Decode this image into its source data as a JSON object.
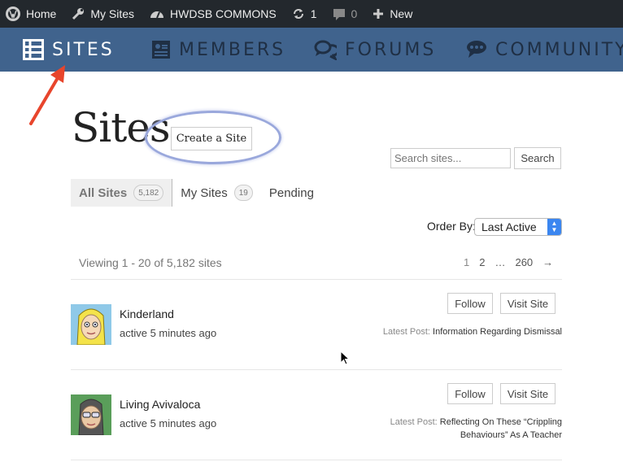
{
  "adminbar": {
    "home_label": "Home",
    "mysites_label": "My Sites",
    "site_name": "HWDSB COMMONS",
    "updates_count": "1",
    "comments_count": "0",
    "new_label": "New"
  },
  "nav": {
    "items": [
      {
        "label": "SITES",
        "icon": "sites-icon"
      },
      {
        "label": "MEMBERS",
        "icon": "members-icon"
      },
      {
        "label": "FORUMS",
        "icon": "forums-icon"
      },
      {
        "label": "COMMUNITY",
        "icon": "community-icon"
      }
    ]
  },
  "page": {
    "title": "Sites",
    "create_label": "Create a Site"
  },
  "search": {
    "placeholder": "Search sites...",
    "button_label": "Search"
  },
  "tabs": {
    "all_label": "All Sites",
    "all_count": "5,182",
    "my_label": "My Sites",
    "my_count": "19",
    "pending_label": "Pending"
  },
  "order": {
    "label": "Order By:",
    "selected": "Last Active"
  },
  "listing": {
    "viewing": "Viewing 1 - 20 of 5,182 sites",
    "pages": [
      "1",
      "2",
      "…",
      "260",
      "→"
    ]
  },
  "sites": [
    {
      "name": "Kinderland",
      "active": "active 5 minutes ago",
      "follow_label": "Follow",
      "visit_label": "Visit Site",
      "latest_prefix": "Latest Post:",
      "latest_line1": "Information Regarding Dismissal",
      "latest_line2": ""
    },
    {
      "name": "Living Avivaloca",
      "active": "active 5 minutes ago",
      "follow_label": "Follow",
      "visit_label": "Visit Site",
      "latest_prefix": "Latest Post:",
      "latest_line1": "Reflecting On These “Crippling",
      "latest_line2": "Behaviours” As A Teacher"
    }
  ],
  "colors": {
    "adminbar": "#23282d",
    "nav": "#40638d",
    "highlight": "#9aa8dc",
    "arrow": "#e8452c"
  }
}
